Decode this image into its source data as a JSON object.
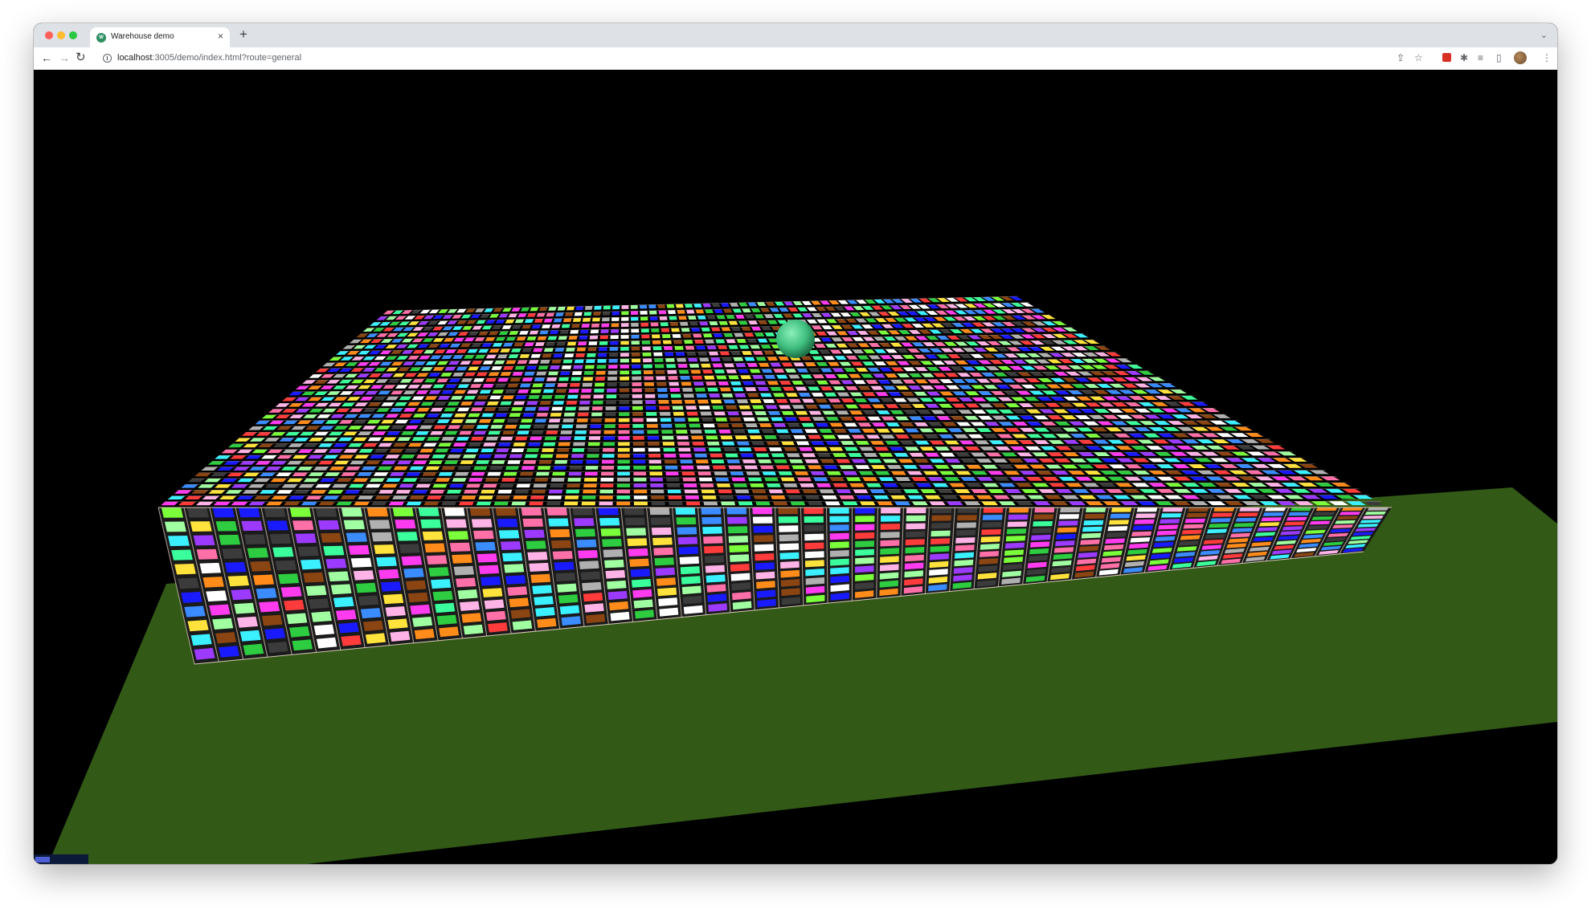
{
  "browser": {
    "tab": {
      "title": "Warehouse demo",
      "favicon": "warehouse-favicon"
    },
    "address": {
      "host": "localhost",
      "rest": ":3005/demo/index.html?route=general"
    },
    "icons": {
      "back": "arrow-left-icon",
      "forward": "arrow-right-icon",
      "reload": "reload-icon",
      "info": "info-icon",
      "share": "share-icon",
      "bookmark": "star-icon",
      "extension": "extension-icon",
      "puzzle": "puzzle-icon",
      "reading_list": "reading-list-icon",
      "side_panel": "side-panel-icon",
      "profile": "avatar-icon",
      "menu": "kebab-menu-icon"
    }
  },
  "scene": {
    "background_color": "#000000",
    "floor_color": "#325a16",
    "sphere_color": "#3fbf7f",
    "rack_frame_color": "#d8c8b8",
    "box_palette": [
      "#ff3b3b",
      "#ff8c1a",
      "#ffe23b",
      "#7cff3b",
      "#2ecc40",
      "#3bff9c",
      "#3bf0ff",
      "#3b8cff",
      "#1a1aff",
      "#9c3bff",
      "#ff3bf0",
      "#ff6fa8",
      "#ffffff",
      "#b0b0b0",
      "#8b4513",
      "#a0ffa0",
      "#ffb3e6",
      "#3b3b3b"
    ]
  }
}
